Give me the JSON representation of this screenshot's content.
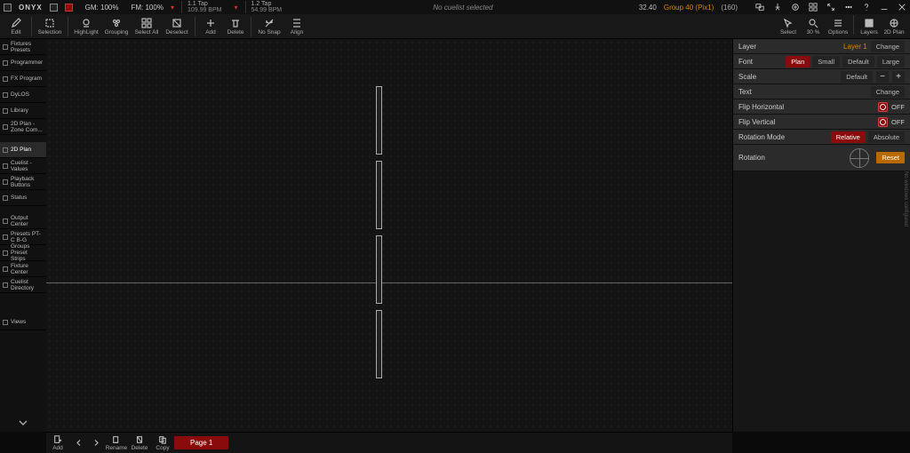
{
  "app": {
    "name": "ONYX"
  },
  "status": {
    "gm": "GM: 100%",
    "fm": "FM: 100%",
    "tap1": {
      "title": "1.1 Tap",
      "value": "109.99 BPM"
    },
    "tap2": {
      "title": "1.2 Tap",
      "value": "54.99 BPM"
    },
    "center": "No cuelist selected",
    "timecode": "32.40",
    "group": "Group 40 (Pix1)",
    "count": "(160)"
  },
  "toolbar": {
    "edit": "Edit",
    "selection": "Selection",
    "highlight": "HighLight",
    "grouping": "Grouping",
    "select_all": "Select All",
    "deselect": "Deselect",
    "add": "Add",
    "delete": "Delete",
    "nosnap": "No Snap",
    "align": "Align",
    "select_r": "Select",
    "zoom": "30 %",
    "options": "Options",
    "layers": "Layers",
    "plan2d": "2D Plan"
  },
  "sidebar": {
    "items": [
      {
        "label": "Fixtures Presets"
      },
      {
        "label": "Programmer"
      },
      {
        "label": "FX Program"
      },
      {
        "label": "DyLOS"
      },
      {
        "label": "Library"
      },
      {
        "label": "2D Plan - Zone Com..."
      },
      {
        "label": "2D Plan"
      },
      {
        "label": "Cuelist - Values"
      },
      {
        "label": "Playback Buttons"
      },
      {
        "label": "Status"
      },
      {
        "label": "Output Center"
      },
      {
        "label": "Presets PT-C B-G"
      },
      {
        "label": "Groups Preset Strips"
      },
      {
        "label": "Fixture Center"
      },
      {
        "label": "Cuelist Directory"
      }
    ],
    "views": "Views",
    "active_index": 6
  },
  "rpanel": {
    "layer_label": "Layer",
    "layer_value": "Layer 1",
    "change": "Change",
    "font_label": "Font",
    "font_opts": [
      "Plan",
      "Small",
      "Default",
      "Large"
    ],
    "font_active": 0,
    "scale_label": "Scale",
    "scale_default": "Default",
    "text_label": "Text",
    "flip_h": "Flip Horizontal",
    "flip_v": "Flip Vertical",
    "off": "OFF",
    "rotmode_label": "Rotation Mode",
    "rotmode_opts": [
      "Relative",
      "Absolute"
    ],
    "rotmode_active": 0,
    "rotation_label": "Rotation",
    "reset": "Reset"
  },
  "side_hint": "No windows configured",
  "bottombar": {
    "add": "Add",
    "rename": "Rename",
    "delete": "Delete",
    "copy": "Copy",
    "page": "Page 1"
  }
}
